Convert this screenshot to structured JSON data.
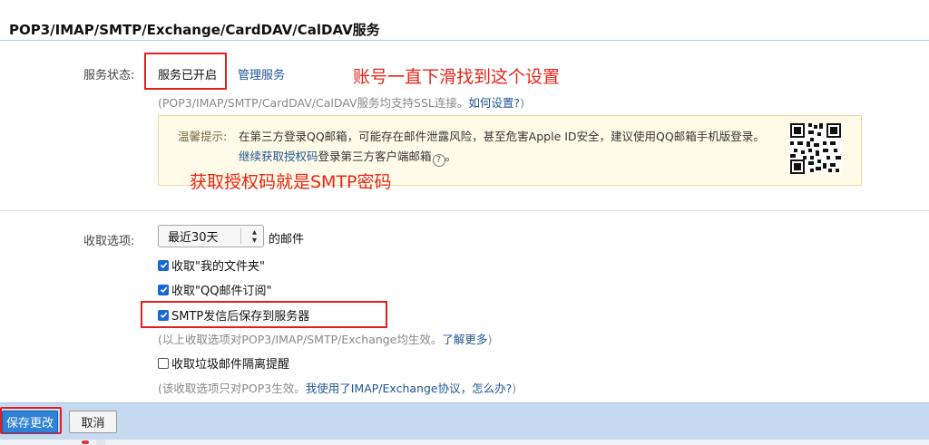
{
  "section": {
    "title": "POP3/IMAP/SMTP/Exchange/CardDAV/CalDAV服务"
  },
  "service": {
    "label": "服务状态:",
    "status": "服务已开启",
    "manage_link": "管理服务",
    "note_prefix": "(POP3/IMAP/SMTP/CardDAV/CalDAV服务均支持SSL连接。",
    "note_link": "如何设置?",
    "note_suffix": ")"
  },
  "annotations": {
    "scroll_hint": "账号一直下滑找到这个设置",
    "auth_hint": "获取授权码就是SMTP密码"
  },
  "warning": {
    "label": "温馨提示:",
    "text": "在第三方登录QQ邮箱，可能存在邮件泄露风险，甚至危害Apple ID安全，建议使用QQ邮箱手机版登录。",
    "link": "继续获取授权码",
    "suffix": "登录第三方客户端邮箱",
    "help_icon": "question-circle-icon"
  },
  "receive": {
    "label": "收取选项:",
    "range_selected": "最近30天",
    "range_suffix": "的邮件",
    "options": [
      {
        "label": "收取\"我的文件夹\"",
        "checked": true
      },
      {
        "label": "收取\"QQ邮件订阅\"",
        "checked": true
      },
      {
        "label": "SMTP发信后保存到服务器",
        "checked": true
      }
    ],
    "note1_prefix": "(以上收取选项对POP3/IMAP/SMTP/Exchange均生效。",
    "note1_link": "了解更多",
    "note1_suffix": ")",
    "spam_label": "收取垃圾邮件隔离提醒",
    "spam_checked": false,
    "note2_prefix": "(该收取选项只对POP3生效。",
    "note2_link": "我使用了IMAP/Exchange协议，怎么办?",
    "note2_suffix": ")"
  },
  "buttons": {
    "save": "保存更改",
    "cancel": "取消"
  },
  "colors": {
    "annotation_red": "#e8261a",
    "link_blue": "#1e5494",
    "footer_bg": "#c5d9f0",
    "save_button": "#2f82d6"
  }
}
